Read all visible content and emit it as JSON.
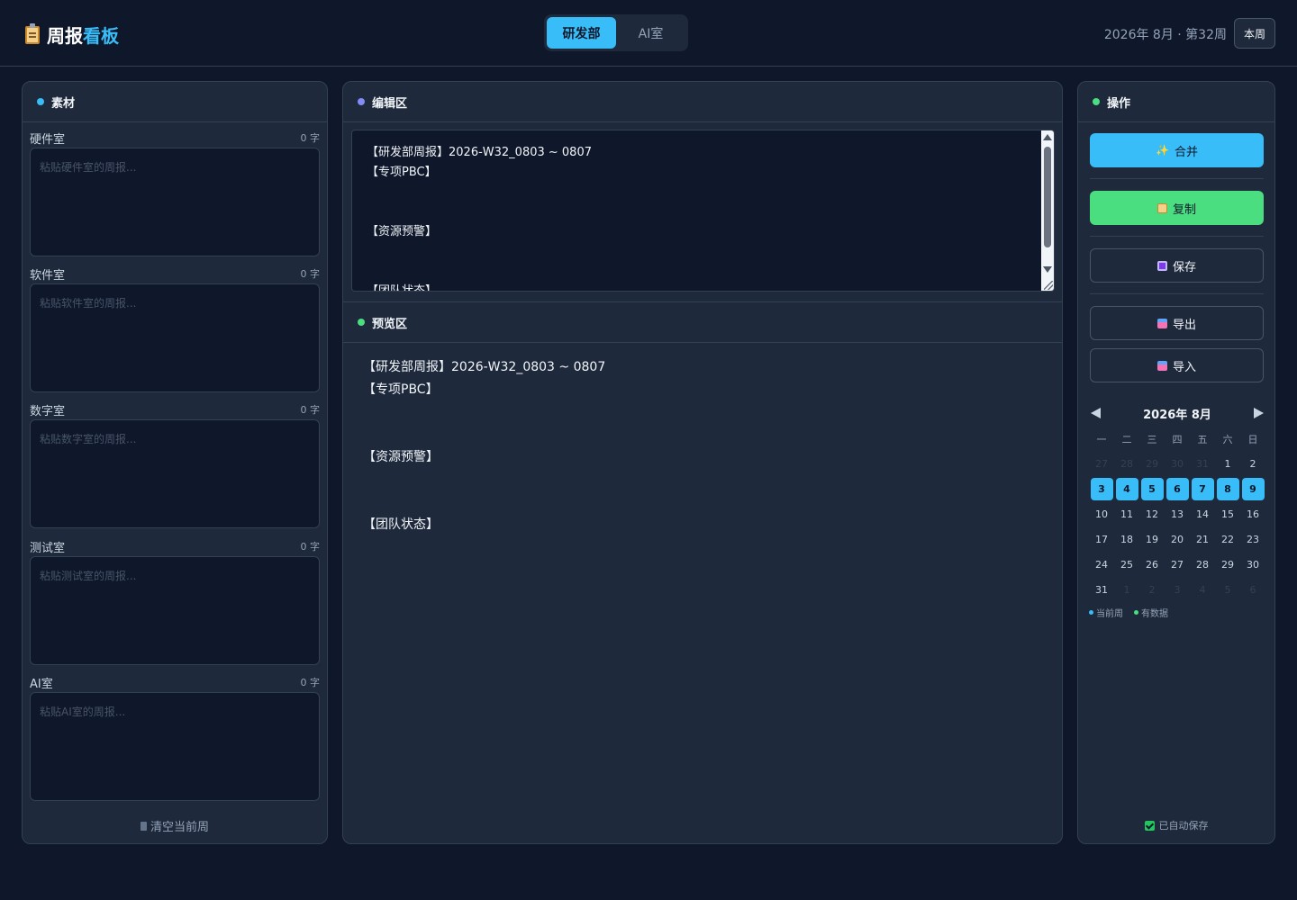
{
  "header": {
    "title_main": "周报",
    "title_accent": "看板",
    "tabs": [
      {
        "label": "研发部",
        "active": true
      },
      {
        "label": "AI室",
        "active": false
      }
    ],
    "week_label": "2026年 8月 · 第32周",
    "this_week_button": "本周"
  },
  "left": {
    "title": "素材",
    "fields": [
      {
        "label": "硬件室",
        "count": "0 字",
        "placeholder": "粘贴硬件室的周报..."
      },
      {
        "label": "软件室",
        "count": "0 字",
        "placeholder": "粘贴软件室的周报..."
      },
      {
        "label": "数字室",
        "count": "0 字",
        "placeholder": "粘贴数字室的周报..."
      },
      {
        "label": "测试室",
        "count": "0 字",
        "placeholder": "粘贴测试室的周报..."
      },
      {
        "label": "AI室",
        "count": "0 字",
        "placeholder": "粘贴AI室的周报..."
      }
    ],
    "clear_button": "清空当前周"
  },
  "middle": {
    "editor_title": "编辑区",
    "editor_text": "【研发部周报】2026-W32_0803 ~ 0807\n【专项PBC】\n\n\n【资源预警】\n\n\n【团队状态】",
    "preview_title": "预览区",
    "preview_text": "【研发部周报】2026-W32_0803 ~ 0807\n【专项PBC】\n\n\n【资源预警】\n\n\n【团队状态】"
  },
  "right": {
    "title": "操作",
    "merge": "合并",
    "copy": "复制",
    "save": "保存",
    "export": "导出",
    "import": "导入",
    "calendar": {
      "title": "2026年 8月",
      "weekdays": [
        "一",
        "二",
        "三",
        "四",
        "五",
        "六",
        "日"
      ],
      "days": [
        [
          "27",
          "28",
          "29",
          "30",
          "31",
          "1",
          "2"
        ],
        [
          "3",
          "4",
          "5",
          "6",
          "7",
          "8",
          "9"
        ],
        [
          "10",
          "11",
          "12",
          "13",
          "14",
          "15",
          "16"
        ],
        [
          "17",
          "18",
          "19",
          "20",
          "21",
          "22",
          "23"
        ],
        [
          "24",
          "25",
          "26",
          "27",
          "28",
          "29",
          "30"
        ],
        [
          "31",
          "1",
          "2",
          "3",
          "4",
          "5",
          "6"
        ]
      ],
      "current_week_row": 1,
      "legend_current": "当前周",
      "legend_data": "有数据"
    },
    "autosave": "已自动保存"
  },
  "colors": {
    "accent": "#38bdf8",
    "success": "#4ade80",
    "editor_dot": "#818cf8",
    "background": "#0f172a",
    "panel": "#1e293b"
  }
}
